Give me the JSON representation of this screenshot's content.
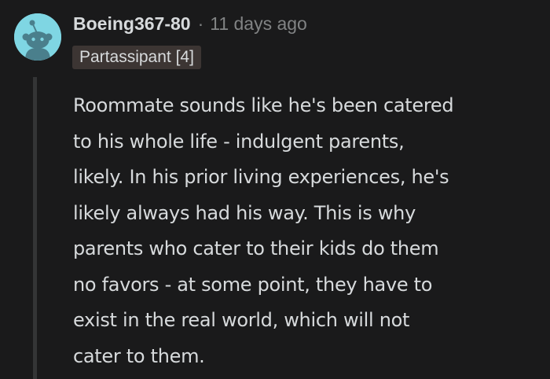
{
  "comment": {
    "author": "Boeing367-80",
    "separator": "·",
    "timestamp": "11 days ago",
    "flair": "Partassipant [4]",
    "avatar_icon": "snoo-avatar-icon",
    "body_lines": [
      "Roommate sounds like he's been catered",
      "to his whole life - indulgent parents,",
      "likely. In his prior living experiences, he's",
      "likely always had his way. This is why",
      "parents who cater to their kids do them",
      "no favors - at some point, they have to",
      "exist in the real world, which will not",
      "cater to them."
    ]
  },
  "colors": {
    "background": "#1a1a1b",
    "text": "#d7dadc",
    "meta": "#818384",
    "avatar": "#7fd6e3",
    "flair_bg": "#3c3533",
    "thread_line": "#343536"
  }
}
